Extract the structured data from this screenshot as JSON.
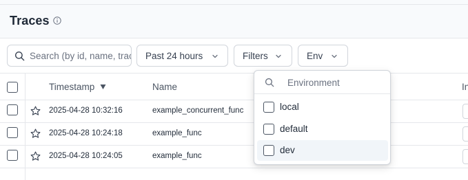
{
  "header": {
    "title": "Traces",
    "info_icon": "info-icon"
  },
  "toolbar": {
    "search": {
      "placeholder": "Search (by id, name, trace",
      "value": ""
    },
    "time_range": {
      "label": "Past 24 hours",
      "icon": "chevron-down-icon"
    },
    "filters": {
      "label": "Filters",
      "icon": "chevron-down-icon"
    },
    "env": {
      "label": "Env",
      "icon": "chevron-down-icon"
    }
  },
  "table": {
    "columns": [
      {
        "label": "Timestamp",
        "sort": "descending",
        "sort_icon": "sort-desc-icon"
      },
      {
        "label": "Name"
      },
      {
        "label": "In"
      }
    ],
    "rows": [
      {
        "timestamp": "2025-04-28 10:32:16",
        "name": "example_concurrent_func",
        "starred": false
      },
      {
        "timestamp": "2025-04-28 10:24:18",
        "name": "example_func",
        "starred": false
      },
      {
        "timestamp": "2025-04-28 10:24:05",
        "name": "example_func",
        "starred": false
      }
    ]
  },
  "env_dropdown": {
    "search_placeholder": "Environment",
    "options": [
      {
        "label": "local",
        "checked": false
      },
      {
        "label": "default",
        "checked": false
      },
      {
        "label": "dev",
        "checked": false,
        "highlighted": true
      }
    ]
  },
  "colors": {
    "border": "#d1d5db",
    "header_bg": "#f8fafc",
    "highlight_bg": "#f1f5f9",
    "text": "#1f2937",
    "muted": "#6b7280"
  }
}
